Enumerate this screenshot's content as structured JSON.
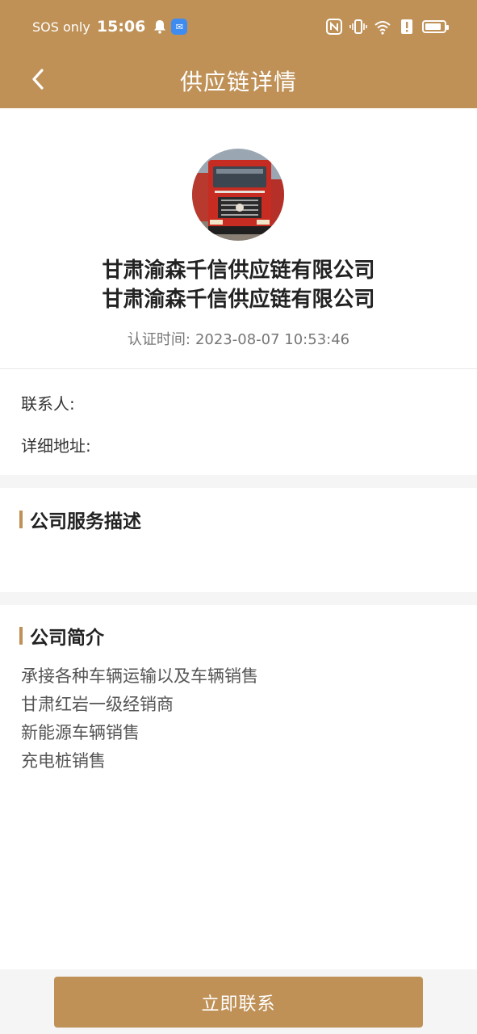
{
  "status_bar": {
    "network_text": "SOS only",
    "time": "15:06",
    "battery_level": 0.85
  },
  "nav": {
    "title": "供应链详情"
  },
  "profile": {
    "name_line1": "甘肃渝森千信供应链有限公司",
    "name_line2": "甘肃渝森千信供应链有限公司",
    "cert_label": "认证时间:",
    "cert_time": "2023-08-07 10:53:46"
  },
  "info": {
    "contact_label": "联系人:",
    "address_label": "详细地址:"
  },
  "sections": {
    "service_title": "公司服务描述",
    "intro_title": "公司简介",
    "intro_lines": [
      "承接各种车辆运输以及车辆销售",
      "甘肃红岩一级经销商",
      "新能源车辆销售",
      "充电桩销售"
    ]
  },
  "footer": {
    "contact_button": "立即联系"
  },
  "colors": {
    "brand": "#bf9157",
    "band": "#f5f5f5"
  }
}
